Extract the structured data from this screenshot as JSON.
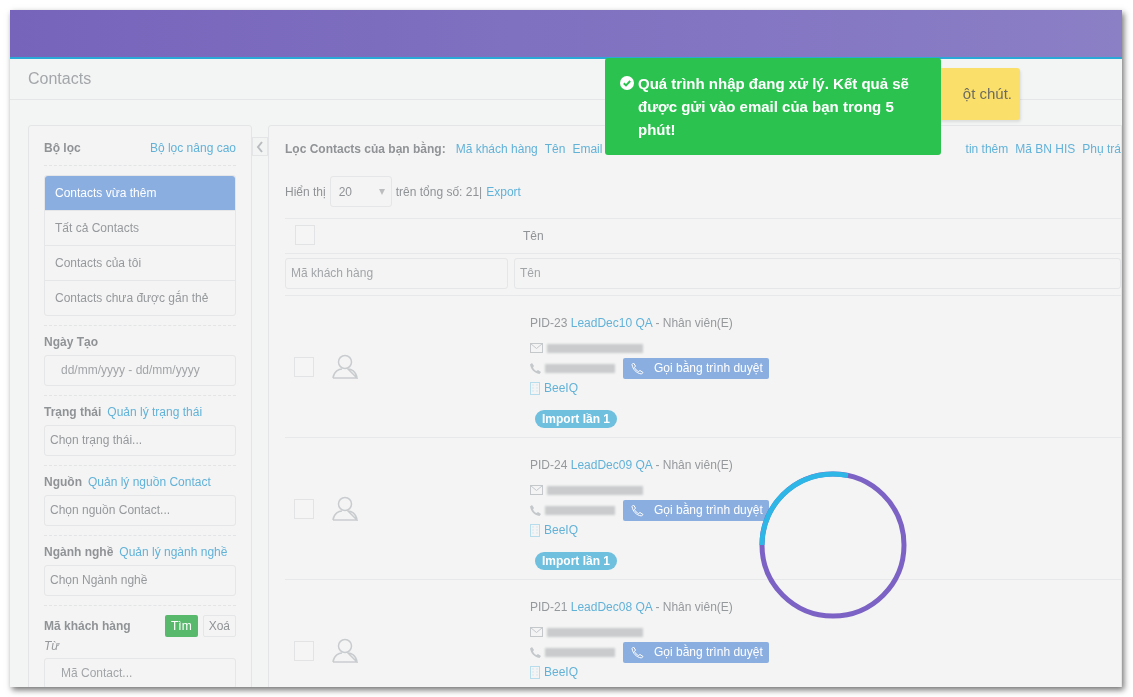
{
  "page_title": "Contacts",
  "sidebar": {
    "title": "Bộ lọc",
    "advanced_link": "Bộ lọc nâng cao",
    "items": [
      {
        "label": "Contacts vừa thêm",
        "selected": true
      },
      {
        "label": "Tất cả Contacts",
        "selected": false
      },
      {
        "label": "Contacts của tôi",
        "selected": false
      },
      {
        "label": "Contacts chưa được gắn thẻ",
        "selected": false
      }
    ],
    "filters": [
      {
        "label": "Ngày Tạo",
        "placeholder": "dd/mm/yyyy - dd/mm/yyyy",
        "kind": "date"
      },
      {
        "label": "Trạng thái",
        "link": "Quản lý trạng thái",
        "placeholder": "Chọn trạng thái...",
        "kind": "select"
      },
      {
        "label": "Nguồn",
        "link": "Quản lý nguồn Contact",
        "placeholder": "Chọn nguồn Contact...",
        "kind": "select"
      },
      {
        "label": "Ngành nghề",
        "link": "Quản lý ngành nghề",
        "placeholder": "Chọn Ngành nghề",
        "kind": "select"
      }
    ],
    "customer_code": {
      "label": "Mã khách hàng",
      "search_button": "Tìm",
      "clear_button": "Xoá",
      "from_label": "Từ",
      "placeholder": "Mã Contact..."
    }
  },
  "toolbar": {
    "filter_label": "Lọc Contacts của bạn bằng:",
    "filter_links": [
      "Mã khách hàng",
      "Tên",
      "Email"
    ],
    "filter_links_right": [
      "tin thêm",
      "Mã BN HIS",
      "Phụ trá"
    ]
  },
  "paging": {
    "show_label": "Hiển thị",
    "page_size": "20",
    "total": "trên tổng số: 21|",
    "export": "Export"
  },
  "table": {
    "header_checked": false,
    "columns": [
      "Tên"
    ],
    "filters": [
      {
        "placeholder": "Mã khách hàng"
      },
      {
        "placeholder": "Tên"
      }
    ],
    "rows": [
      {
        "checked": false,
        "pid": "PID-23",
        "name": "LeadDec10 QA",
        "role": "- Nhân viên(E)",
        "call_button": "Gọi bằng trình duyệt",
        "company": "BeeIQ",
        "tag": "Import lần 1"
      },
      {
        "checked": false,
        "pid": "PID-24",
        "name": "LeadDec09 QA",
        "role": "- Nhân viên(E)",
        "call_button": "Gọi bằng trình duyệt",
        "company": "BeeIQ",
        "tag": "Import lần 1"
      },
      {
        "checked": false,
        "pid": "PID-21",
        "name": "LeadDec08 QA",
        "role": "- Nhân viên(E)",
        "call_button": "Gọi bằng trình duyệt",
        "company": "BeeIQ"
      }
    ]
  },
  "notifications": [
    {
      "kind": "success",
      "text": "Quá trình nhập đang xử lý. Kết quả sẽ được gửi vào email của bạn trong 5 phút!"
    },
    {
      "kind": "warning",
      "text": "ột chút."
    }
  ],
  "loading": true
}
